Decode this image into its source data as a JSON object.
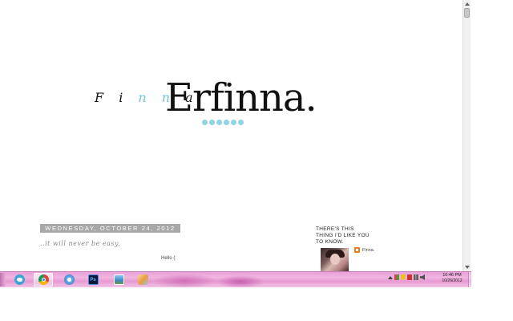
{
  "blog": {
    "logo_small_prefix": "F i ",
    "logo_small_accent": "n n",
    "logo_small_suffix": " a",
    "logo_big": "Erfinna.",
    "dot_count": 6,
    "accent_color": "#8fd3e6"
  },
  "post": {
    "date": "WEDNESDAY, OCTOBER 24, 2012",
    "title": "..it will never be easy.",
    "body": "Hello (:"
  },
  "sidebar": {
    "title": "THERE'S THIS THING I'D LIKE YOU TO KNOW.",
    "profile_name": "Finna."
  },
  "taskbar": {
    "apps": [
      {
        "name": "twitter-icon"
      },
      {
        "name": "chrome-icon"
      },
      {
        "name": "itunes-icon"
      },
      {
        "name": "photoshop-icon",
        "label": "Ps"
      },
      {
        "name": "photo-viewer-icon"
      },
      {
        "name": "paint-icon"
      }
    ],
    "clock_time": "10:46 PM",
    "clock_date": "10/26/2012"
  }
}
